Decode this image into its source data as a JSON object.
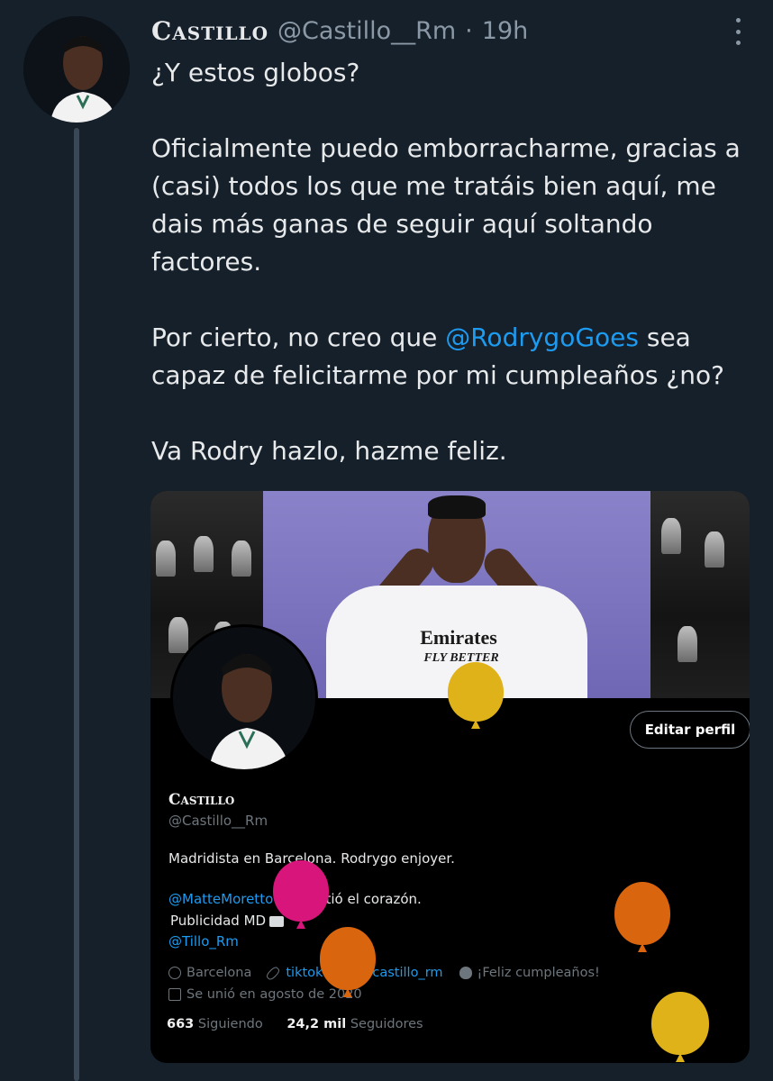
{
  "tweet": {
    "display_name": "Castillo",
    "handle": "@Castillo__Rm",
    "dot": "·",
    "time": "19h",
    "paragraphs": {
      "p1": "¿Y estos globos?",
      "p2": "Oficialmente puedo emborracharme, gracias a (casi) todos los que me tratáis bien aquí, me dais más ganas de seguir aquí soltando factores.",
      "p3_before": "Por cierto, no creo que ",
      "p3_mention": "@RodrygoGoes",
      "p3_after": " sea capaz de felicitarme por mi cumpleaños ¿no?",
      "p4": "Va Rodry hazlo, hazme feliz."
    }
  },
  "profile_card": {
    "banner_text_1": "Emirates",
    "banner_text_2": "FLY BETTER",
    "edit_button": "Editar perfil",
    "name": "Castillo",
    "handle": "@Castillo__Rm",
    "bio": "Madridista en Barcelona. Rodrygo enjoyer.",
    "bio_mention": "@MatteMoretto",
    "bio_mention_rest": " me partió el corazón.",
    "bio_ads": "Publicidad MD",
    "bio_link": "@Tillo_Rm",
    "location": "Barcelona",
    "website": "tiktok.com/@castillo_rm",
    "birthday": "¡Feliz cumpleaños!",
    "joined": "Se unió en agosto de 2020",
    "following_count": "663",
    "following_label": "Siguiendo",
    "followers_count": "24,2 mil",
    "followers_label": "Seguidores"
  },
  "colors": {
    "background": "#15202b",
    "link": "#1d9bf0",
    "balloon_yellow": "#e0b21a",
    "balloon_orange": "#d9650f",
    "balloon_pink": "#d8157a"
  }
}
